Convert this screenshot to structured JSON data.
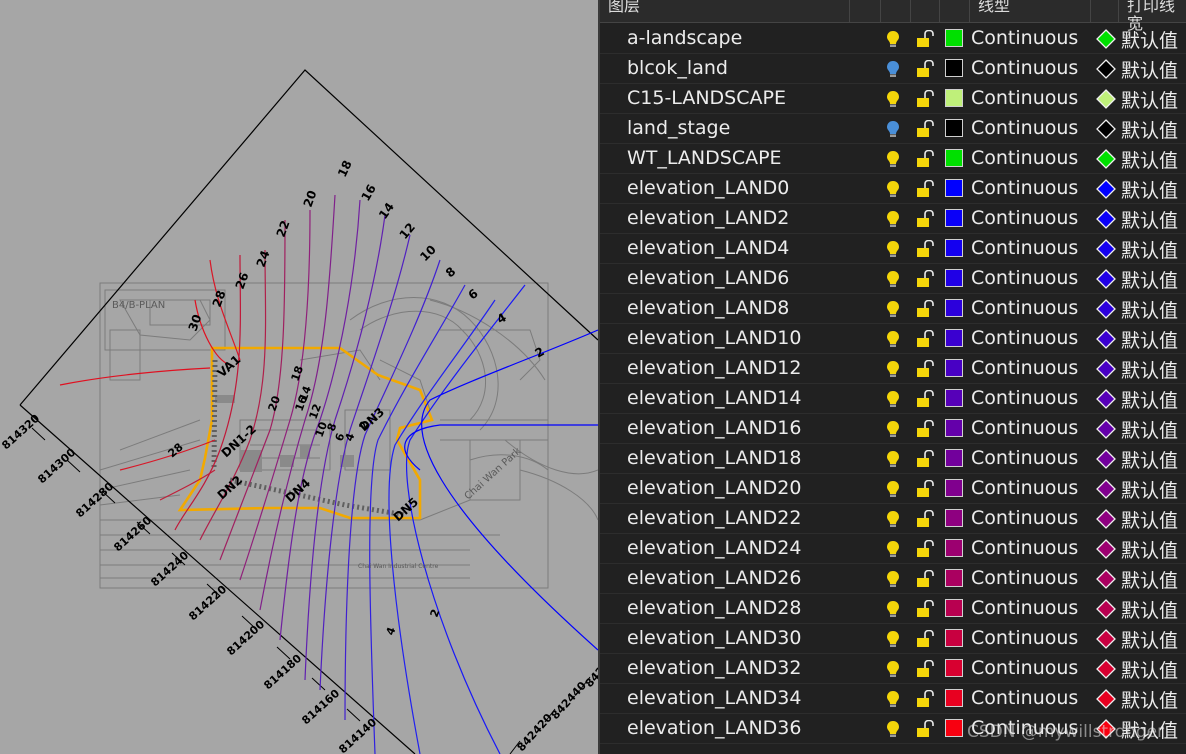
{
  "header": {
    "col_layer": "图层",
    "col_linetype": "线型",
    "col_plotstyle": "打印线宽"
  },
  "layers": [
    {
      "name": "a-landscape",
      "bulb": "on",
      "color": "#00e000",
      "linetype": "Continuous",
      "plot_style": "默认值"
    },
    {
      "name": "blcok_land",
      "bulb": "off",
      "color": "#000000",
      "linetype": "Continuous",
      "plot_style": "默认值"
    },
    {
      "name": "C15-LANDSCAPE",
      "bulb": "on",
      "color": "#bff07a",
      "linetype": "Continuous",
      "plot_style": "默认值"
    },
    {
      "name": "land_stage",
      "bulb": "off",
      "color": "#000000",
      "linetype": "Continuous",
      "plot_style": "默认值"
    },
    {
      "name": "WT_LANDSCAPE",
      "bulb": "on",
      "color": "#00e000",
      "linetype": "Continuous",
      "plot_style": "默认值"
    },
    {
      "name": "elevation_LAND0",
      "bulb": "on",
      "color": "#0000ff",
      "linetype": "Continuous",
      "plot_style": "默认值"
    },
    {
      "name": "elevation_LAND2",
      "bulb": "on",
      "color": "#0a00f8",
      "linetype": "Continuous",
      "plot_style": "默认值"
    },
    {
      "name": "elevation_LAND4",
      "bulb": "on",
      "color": "#1400f0",
      "linetype": "Continuous",
      "plot_style": "默认值"
    },
    {
      "name": "elevation_LAND6",
      "bulb": "on",
      "color": "#2000e6",
      "linetype": "Continuous",
      "plot_style": "默认值"
    },
    {
      "name": "elevation_LAND8",
      "bulb": "on",
      "color": "#2c00dc",
      "linetype": "Continuous",
      "plot_style": "默认值"
    },
    {
      "name": "elevation_LAND10",
      "bulb": "on",
      "color": "#3a00d0",
      "linetype": "Continuous",
      "plot_style": "默认值"
    },
    {
      "name": "elevation_LAND12",
      "bulb": "on",
      "color": "#4800c4",
      "linetype": "Continuous",
      "plot_style": "默认值"
    },
    {
      "name": "elevation_LAND14",
      "bulb": "on",
      "color": "#5600b8",
      "linetype": "Continuous",
      "plot_style": "默认值"
    },
    {
      "name": "elevation_LAND16",
      "bulb": "on",
      "color": "#6400aa",
      "linetype": "Continuous",
      "plot_style": "默认值"
    },
    {
      "name": "elevation_LAND18",
      "bulb": "on",
      "color": "#72009c",
      "linetype": "Continuous",
      "plot_style": "默认值"
    },
    {
      "name": "elevation_LAND20",
      "bulb": "on",
      "color": "#80008e",
      "linetype": "Continuous",
      "plot_style": "默认值"
    },
    {
      "name": "elevation_LAND22",
      "bulb": "on",
      "color": "#8e0080",
      "linetype": "Continuous",
      "plot_style": "默认值"
    },
    {
      "name": "elevation_LAND24",
      "bulb": "on",
      "color": "#9c0070",
      "linetype": "Continuous",
      "plot_style": "默认值"
    },
    {
      "name": "elevation_LAND26",
      "bulb": "on",
      "color": "#aa0060",
      "linetype": "Continuous",
      "plot_style": "默认值"
    },
    {
      "name": "elevation_LAND28",
      "bulb": "on",
      "color": "#b80050",
      "linetype": "Continuous",
      "plot_style": "默认值"
    },
    {
      "name": "elevation_LAND30",
      "bulb": "on",
      "color": "#c80040",
      "linetype": "Continuous",
      "plot_style": "默认值"
    },
    {
      "name": "elevation_LAND32",
      "bulb": "on",
      "color": "#d80030",
      "linetype": "Continuous",
      "plot_style": "默认值"
    },
    {
      "name": "elevation_LAND34",
      "bulb": "on",
      "color": "#e80020",
      "linetype": "Continuous",
      "plot_style": "默认值"
    },
    {
      "name": "elevation_LAND36",
      "bulb": "on",
      "color": "#f80010",
      "linetype": "Continuous",
      "plot_style": "默认值"
    }
  ],
  "drawing": {
    "grid_labels_left": [
      "814320",
      "814300",
      "814280",
      "814260",
      "814240",
      "814220",
      "814200",
      "814180",
      "814160",
      "814140"
    ],
    "grid_labels_bottom": [
      "842420",
      "842440",
      "842"
    ],
    "contour_labels": [
      "30",
      "28",
      "26",
      "24",
      "22",
      "20",
      "18",
      "16",
      "14",
      "12",
      "10",
      "8",
      "6",
      "4",
      "2"
    ],
    "inner_labels": [
      "20",
      "18",
      "16",
      "14",
      "12",
      "10",
      "8",
      "6",
      "4",
      "2",
      "28",
      "2",
      "4"
    ],
    "block_labels": [
      "VA1",
      "DN1-2",
      "DN2",
      "DN4",
      "DN3",
      "DN5"
    ],
    "plan_label": "B4/B-PLAN",
    "road_label": "Chai Wan Park",
    "bottom_text": "Chai Wan Industrial Centre"
  },
  "watermark": "CSDN @mywillstronger"
}
